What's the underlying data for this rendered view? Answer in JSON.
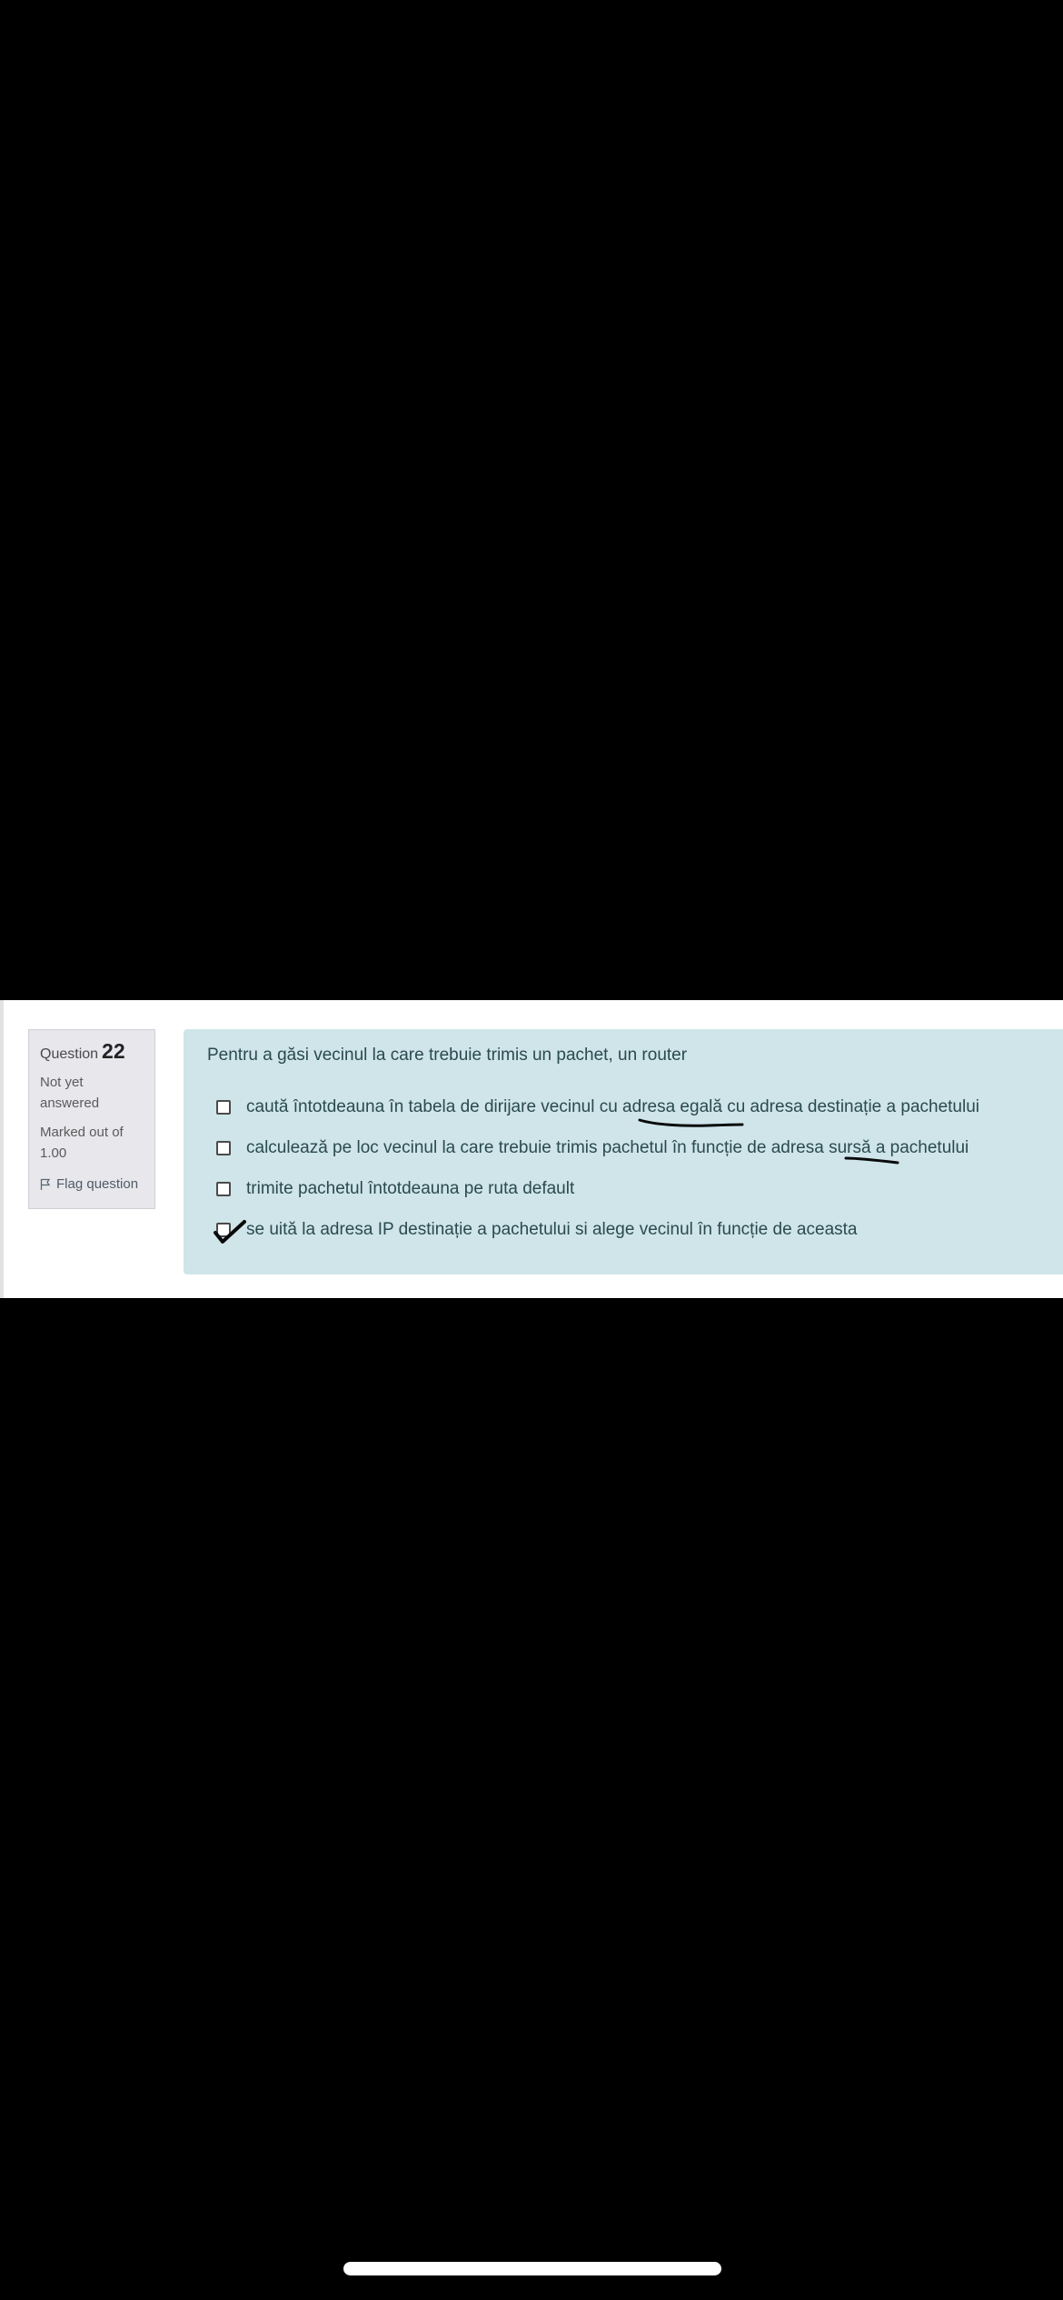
{
  "question": {
    "label": "Question",
    "number": "22",
    "state": "Not yet answered",
    "grade": "Marked out of 1.00",
    "flag_label": "Flag question",
    "text": "Pentru a găsi vecinul la care trebuie trimis un pachet, un router",
    "answers": [
      {
        "text": "caută întotdeauna în tabela de dirijare vecinul cu adresa egală cu adresa destinație a pachetului",
        "checked": false
      },
      {
        "text": "calculează pe loc vecinul la care trebuie trimis pachetul în funcție de adresa sursă a pachetului",
        "checked": false
      },
      {
        "text": "trimite pachetul întotdeauna pe ruta default",
        "checked": false
      },
      {
        "text": "se uită la adresa IP destinație a pachetului si alege vecinul în funcție de aceasta",
        "checked": true
      }
    ]
  },
  "colors": {
    "content_bg": "#cfe5e9",
    "info_bg": "#e7e7ec",
    "text": "#2a4a50"
  },
  "icons": {
    "flag": "flag-outline-icon",
    "handwritten_check": "hand-drawn-checkmark"
  }
}
